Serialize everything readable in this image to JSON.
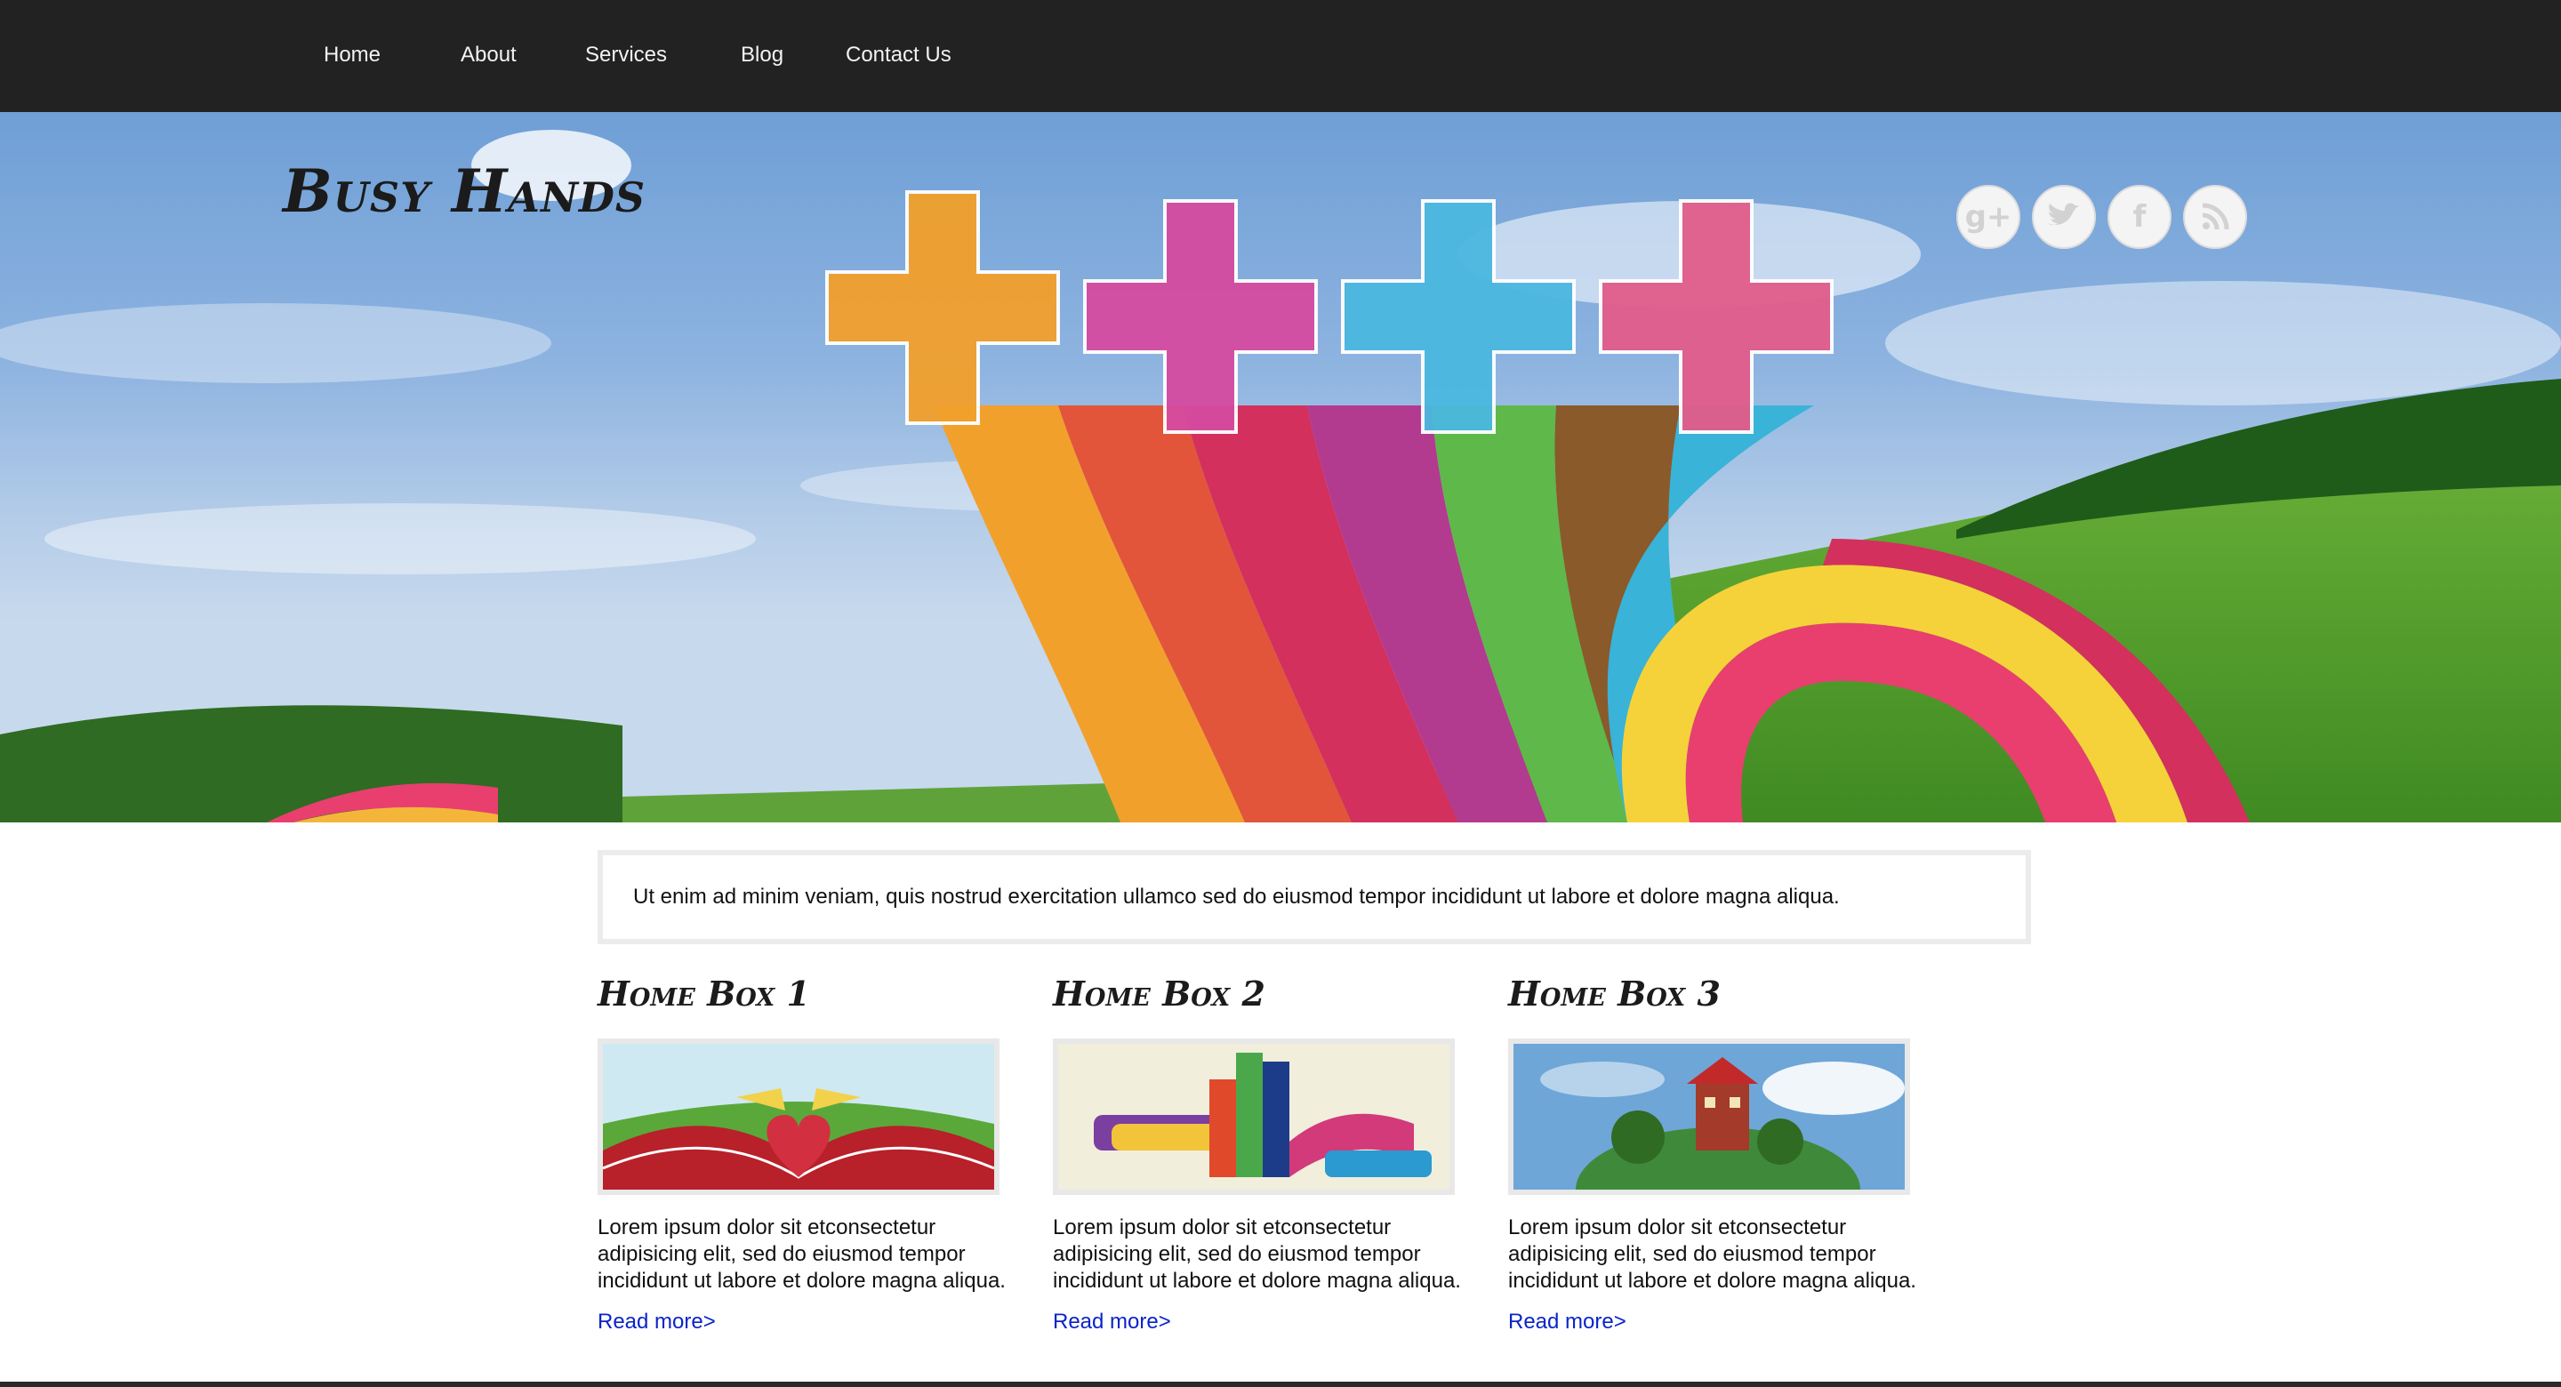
{
  "nav": {
    "items": [
      {
        "label": "Home"
      },
      {
        "label": "About"
      },
      {
        "label": "Services"
      },
      {
        "label": "Blog"
      },
      {
        "label": "Contact Us"
      }
    ]
  },
  "header": {
    "site_title": "Busy Hands",
    "social_icons": [
      "google-plus-icon",
      "twitter-icon",
      "facebook-icon",
      "rss-icon"
    ]
  },
  "intro": {
    "text": "Ut enim ad minim veniam, quis nostrud exercitation ullamco sed do eiusmod tempor incididunt ut labore et dolore magna aliqua."
  },
  "boxes": [
    {
      "title": "Home Box 1",
      "text": "Lorem ipsum dolor sit etconsectetur adipisicing elit, sed do eiusmod tempor incididunt ut labore et dolore magna aliqua.",
      "link": "Read more>"
    },
    {
      "title": "Home Box 2",
      "text": "Lorem ipsum dolor sit etconsectetur adipisicing elit, sed do eiusmod tempor incididunt ut labore et dolore magna aliqua.",
      "link": "Read more>"
    },
    {
      "title": "Home Box 3",
      "text": "Lorem ipsum dolor sit etconsectetur adipisicing elit, sed do eiusmod tempor incididunt ut labore et dolore magna aliqua.",
      "link": "Read more>"
    }
  ],
  "colors": {
    "nav_background": "#222222",
    "nav_text": "#f2f2f2",
    "link": "#0a24c8",
    "box_border": "#e8e8e8"
  }
}
